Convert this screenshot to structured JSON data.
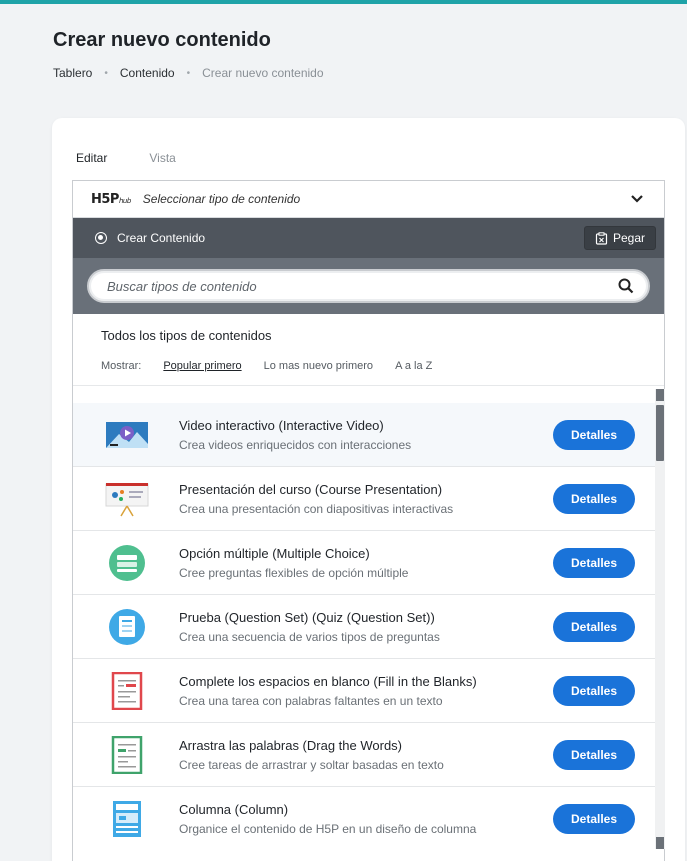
{
  "page": {
    "title": "Crear nuevo contenido",
    "breadcrumb": [
      "Tablero",
      "Contenido",
      "Crear nuevo contenido"
    ]
  },
  "tabs": [
    "Editar",
    "Vista"
  ],
  "hub": {
    "logo": "H5P",
    "logo_sub": "hub",
    "select_label": "Seleccionar tipo de contenido",
    "create_label": "Crear Contenido",
    "paste_label": "Pegar",
    "search_placeholder": "Buscar tipos de contenido",
    "filter_title": "Todos los tipos de contenidos",
    "filter_show": "Mostrar:",
    "filter_options": [
      "Popular primero",
      "Lo mas nuevo primero",
      "A a la Z"
    ]
  },
  "items": [
    {
      "title": "Video interactivo (Interactive Video)",
      "desc": "Crea videos enriquecidos con interacciones",
      "button": "Detalles",
      "icon": "interactive-video-icon"
    },
    {
      "title": "Presentación del curso (Course Presentation)",
      "desc": "Crea una presentación con diapositivas interactivas",
      "button": "Detalles",
      "icon": "course-presentation-icon"
    },
    {
      "title": "Opción múltiple (Multiple Choice)",
      "desc": "Cree preguntas flexibles de opción múltiple",
      "button": "Detalles",
      "icon": "multiple-choice-icon"
    },
    {
      "title": "Prueba (Question Set) (Quiz (Question Set))",
      "desc": "Crea una secuencia de varios tipos de preguntas",
      "button": "Detalles",
      "icon": "question-set-icon"
    },
    {
      "title": "Complete los espacios en blanco (Fill in the Blanks)",
      "desc": "Crea una tarea con palabras faltantes en un texto",
      "button": "Detalles",
      "icon": "fill-blanks-icon"
    },
    {
      "title": "Arrastra las palabras (Drag the Words)",
      "desc": "Cree tareas de arrastrar y soltar basadas en texto",
      "button": "Detalles",
      "icon": "drag-words-icon"
    },
    {
      "title": "Columna (Column)",
      "desc": "Organice el contenido de H5P en un diseño de columna",
      "button": "Detalles",
      "icon": "column-icon"
    }
  ],
  "colors": {
    "accent": "#1fa3a8",
    "button": "#1a73d9",
    "create_bar": "#4f555d",
    "search_band": "#697079"
  }
}
